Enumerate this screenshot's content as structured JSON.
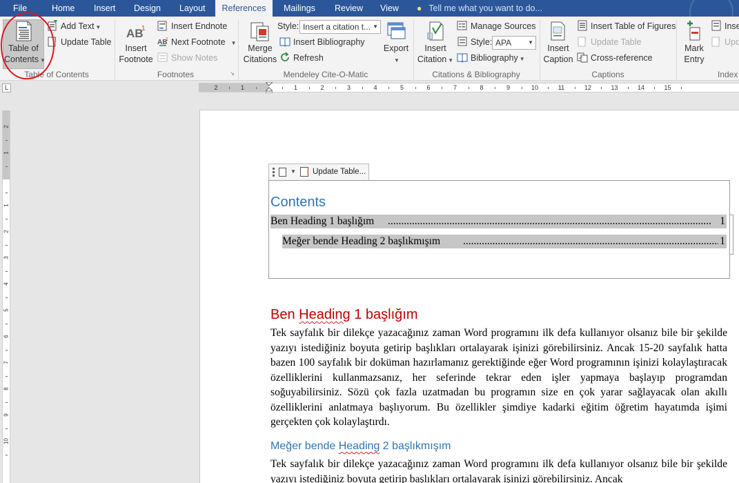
{
  "tabs": [
    {
      "label": "File"
    },
    {
      "label": "Home"
    },
    {
      "label": "Insert"
    },
    {
      "label": "Design"
    },
    {
      "label": "Layout"
    },
    {
      "label": "References",
      "active": true
    },
    {
      "label": "Mailings"
    },
    {
      "label": "Review"
    },
    {
      "label": "View"
    }
  ],
  "tell_me": "Tell me what you want to do...",
  "colors": {
    "accent": "#2b579a",
    "heading1": "#c00000",
    "heading2": "#2e74b5",
    "annotation": "#e0141e"
  },
  "ribbon": {
    "toc_group": {
      "label": "Table of Contents",
      "toc_button_line1": "Table of",
      "toc_button_line2": "Contents",
      "add_text": "Add Text",
      "update_table": "Update Table"
    },
    "footnotes_group": {
      "label": "Footnotes",
      "insert_footnote_line1": "Insert",
      "insert_footnote_line2": "Footnote",
      "insert_endnote": "Insert Endnote",
      "next_footnote": "Next Footnote",
      "show_notes": "Show Notes"
    },
    "mendeley_group": {
      "label": "Mendeley Cite-O-Matic",
      "merge_line1": "Merge",
      "merge_line2": "Citations",
      "style_label": "Style:",
      "style_value": "Insert a citation t...",
      "insert_bibliography": "Insert Bibliography",
      "refresh": "Refresh",
      "export": "Export"
    },
    "citations_group": {
      "label": "Citations & Bibliography",
      "insert_citation_line1": "Insert",
      "insert_citation_line2": "Citation",
      "manage_sources": "Manage Sources",
      "style_label": "Style:",
      "style_value": "APA",
      "bibliography": "Bibliography"
    },
    "captions_group": {
      "label": "Captions",
      "insert_caption_line1": "Insert",
      "insert_caption_line2": "Caption",
      "insert_table_of_figures": "Insert Table of Figures",
      "update_table": "Update Table",
      "cross_reference": "Cross-reference"
    },
    "index_group": {
      "label": "Index",
      "mark_entry_line1": "Mark",
      "mark_entry_line2": "Entry",
      "insert_index": "Inse",
      "update_index": "Upd"
    }
  },
  "ruler": {
    "corner": "L",
    "h_labels": [
      "2",
      "1",
      "",
      "1",
      "2",
      "3",
      "4",
      "5",
      "6",
      "7",
      "8",
      "9",
      "10",
      "11",
      "12",
      "13",
      "14",
      "15"
    ],
    "v_labels": [
      "2",
      "1",
      "",
      "1",
      "2",
      "3",
      "4",
      "5",
      "6",
      "7",
      "8",
      "9",
      "10"
    ]
  },
  "document": {
    "toc_control_label": "Update Table...",
    "contents_title": "Contents",
    "toc_entries": [
      {
        "text": "Ben Heading 1 başlığım",
        "page": "1"
      },
      {
        "text": "Meğer bende Heading 2 başlıkmışım",
        "page": "1"
      }
    ],
    "heading1": {
      "prefix": "Ben ",
      "squiggle": "Heading",
      "suffix": " 1 başlığım"
    },
    "paragraph1": "Tek sayfalık bir dilekçe yazacağınız zaman Word programını ilk defa kullanıyor olsanız bile bir şekilde yazıyı istediğiniz boyuta getirip başlıkları ortalayarak işinizi görebilirsiniz. Ancak 15-20 sayfalık hatta bazen 100 sayfalık bir doküman hazırlamanız gerektiğinde eğer Word programının işinizi kolaylaştıracak özelliklerini kullanmazsanız, her seferinde tekrar eden işler yapmaya başlayıp programdan soğuyabilirsiniz. Sözü çok fazla uzatmadan bu programın size en çok yarar sağlayacak olan akıllı özelliklerini anlatmaya başlıyorum. Bu özellikler şimdiye kadarki eğitim öğretim hayatımda işimi gerçekten çok kolaylaştırdı.",
    "heading2": {
      "prefix": "Meğer bende ",
      "squiggle": "Heading",
      "suffix": " 2 başlıkmışım"
    },
    "paragraph2": "Tek sayfalık bir dilekçe yazacağınız zaman Word programını ilk defa kullanıyor olsanız bile bir şekilde yazıyı istediğiniz boyuta getirip başlıkları ortalayarak işinizi görebilirsiniz. Ancak"
  }
}
